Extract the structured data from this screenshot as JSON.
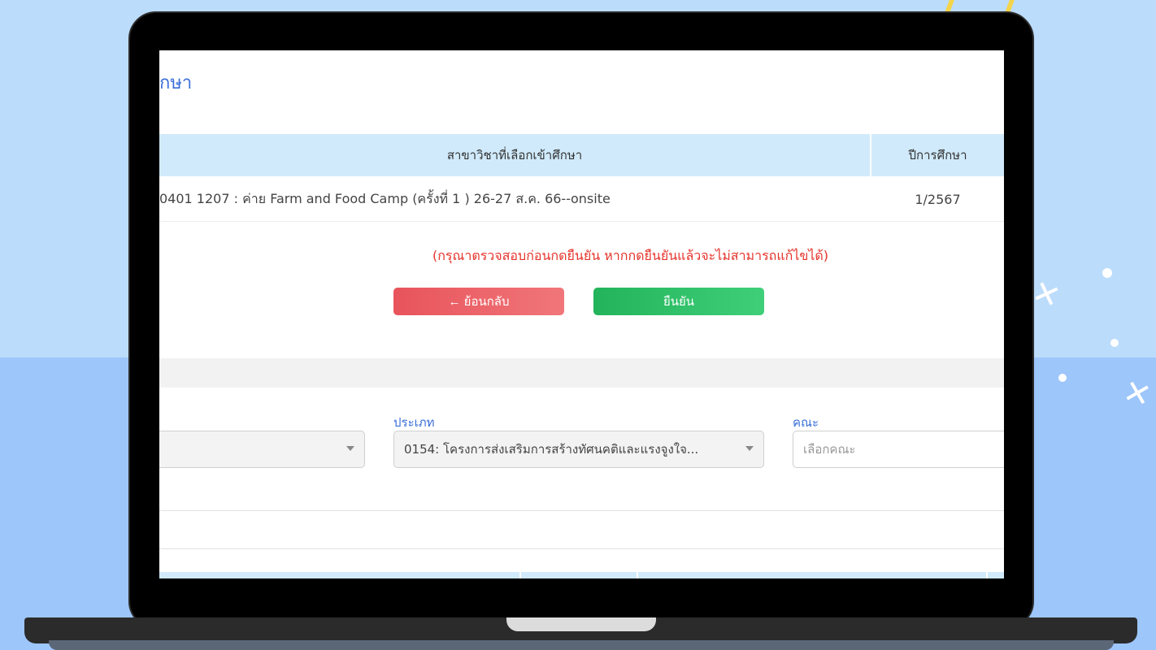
{
  "page": {
    "title_fragment": "ึกษา"
  },
  "table": {
    "headers": {
      "subject": "สาขาวิชาที่เลือกเข้าศึกษา",
      "year": "ปีการศึกษา"
    },
    "rows": [
      {
        "subject": "0401 1207 : ค่าย Farm and Food Camp (ครั้งที่ 1 ) 26-27 ส.ค. 66--onsite",
        "year": "1/2567"
      }
    ]
  },
  "warning_text": "(กรุณาตรวจสอบก่อนกดยืนยัน หากกดยืนยันแล้วจะไม่สามารถแก้ไขได้)",
  "buttons": {
    "back_label": "← ย้อนกลับ",
    "confirm_label": "ยืนยัน"
  },
  "filters": {
    "type_label": "ประเภท",
    "type_value": "0154: โครงการส่งเสริมการสร้างทัศนคติและแรงจูงใจ...",
    "faculty_label": "คณะ",
    "faculty_placeholder": "เลือกคณะ"
  },
  "colors": {
    "accent_blue": "#3a6fd8",
    "warning_red": "#e5342b",
    "back_button": "#e8545b",
    "confirm_button": "#23b35a",
    "table_header": "#d0eafb"
  }
}
